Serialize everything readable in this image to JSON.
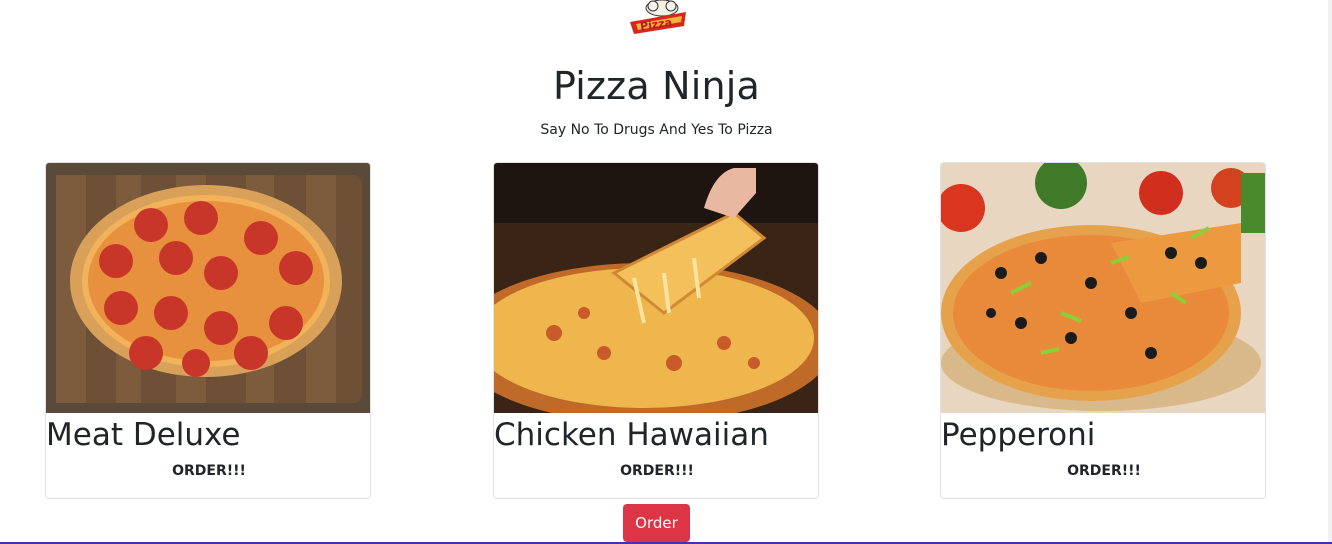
{
  "header": {
    "logo_text": "Pizza",
    "title": "Pizza Ninja",
    "subtitle": "Say No To Drugs And Yes To Pizza"
  },
  "cards": [
    {
      "name": "Meat Deluxe",
      "order_label": "ORDER!!!"
    },
    {
      "name": "Chicken Hawaiian",
      "order_label": "ORDER!!!"
    },
    {
      "name": "Pepperoni",
      "order_label": "ORDER!!!"
    }
  ],
  "order_button": {
    "label": "Order"
  },
  "colors": {
    "order_button": "#dc3545",
    "bottom_border": "#4433aa",
    "card_border": "#dee2e6"
  }
}
